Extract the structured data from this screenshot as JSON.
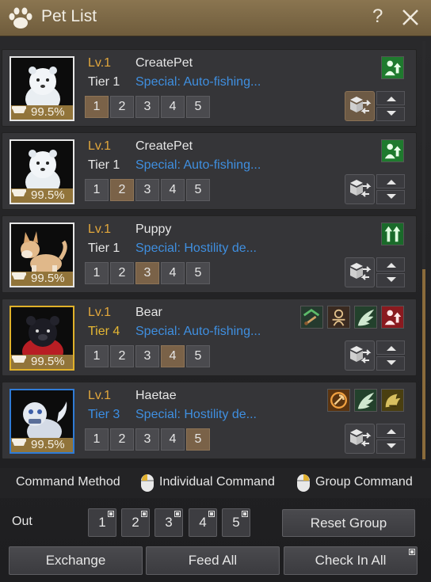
{
  "header": {
    "title": "Pet List",
    "help_glyph": "?",
    "icon": "paw-icon"
  },
  "pets": [
    {
      "level": "Lv.1",
      "name": "CreatePet",
      "tier": "Tier 1",
      "special": "Special: Auto-fishing...",
      "hunger": "99.5%",
      "hunger_fraction": 0.995,
      "active_slot": 1,
      "portrait": "white-bear-pet"
    },
    {
      "level": "Lv.1",
      "name": "CreatePet",
      "tier": "Tier 1",
      "special": "Special: Auto-fishing...",
      "hunger": "99.5%",
      "hunger_fraction": 0.995,
      "active_slot": 2,
      "portrait": "white-bear-pet"
    },
    {
      "level": "Lv.1",
      "name": "Puppy",
      "tier": "Tier 1",
      "special": "Special: Hostility de...",
      "hunger": "99.5%",
      "hunger_fraction": 0.995,
      "active_slot": 3,
      "portrait": "shiba-puppy"
    },
    {
      "level": "Lv.1",
      "name": "Bear",
      "tier": "Tier 4",
      "special": "Special: Auto-fishing...",
      "hunger": "99.5%",
      "hunger_fraction": 0.995,
      "active_slot": 4,
      "portrait": "black-bear-pet"
    },
    {
      "level": "Lv.1",
      "name": "Haetae",
      "tier": "Tier 3",
      "special": "Special: Hostility de...",
      "hunger": "99.5%",
      "hunger_fraction": 0.995,
      "active_slot": 5,
      "portrait": "haetae-pet"
    }
  ],
  "slots": [
    "1",
    "2",
    "3",
    "4",
    "5"
  ],
  "command_method": {
    "label": "Command Method",
    "individual": "Individual Command",
    "group": "Group Command"
  },
  "out": {
    "label": "Out",
    "buttons": [
      "1",
      "2",
      "3",
      "4",
      "5"
    ],
    "reset_group": "Reset Group"
  },
  "footer": {
    "exchange": "Exchange",
    "feed_all": "Feed All",
    "check_in_all": "Check In All"
  },
  "colors": {
    "header": "#7d6a47",
    "level": "#e2a73c",
    "special": "#3f8fe0",
    "tier_gold": "#e5b733",
    "tier_blue": "#3b8fe6",
    "active_slot": "#7a6248"
  }
}
